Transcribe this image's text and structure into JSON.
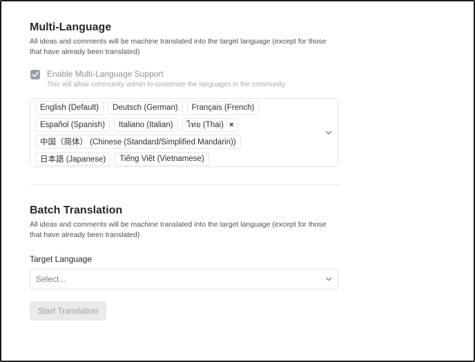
{
  "multi_language": {
    "title": "Multi-Language",
    "description": "All ideas and comments will be machine translated into the target language (except for those that have already been translated)",
    "enable_checkbox": {
      "checked": true,
      "label": "Enable Multi-Language Support",
      "sublabel": "This will allow community admin to customize the languages in the community"
    },
    "languages": {
      "selected": [
        [
          "English (Default)",
          "Deutsch (German)",
          "Français (French)"
        ],
        [
          "Español (Spanish)",
          "Italiano (Italian)",
          "ไทย (Thai)"
        ],
        [
          "中国（简体） (Chinese (Standard/Simplified Mandarin))"
        ],
        [
          "日本語 (Japanese)",
          "Tiếng Việt (Vietnamese)"
        ]
      ],
      "removable_chip": "ไทย (Thai)",
      "remove_icon": "×"
    }
  },
  "batch_translation": {
    "title": "Batch Translation",
    "description": "All ideas and comments will be machine translated into the target language (except for those that have already been translated)",
    "target_language_label": "Target Language",
    "target_language_placeholder": "Select...",
    "start_button_label": "Start Translation",
    "start_button_disabled": true
  },
  "icons": {
    "checkbox": "checkmark-icon",
    "dropdown": "chevron-down-icon",
    "remove": "close-icon"
  }
}
